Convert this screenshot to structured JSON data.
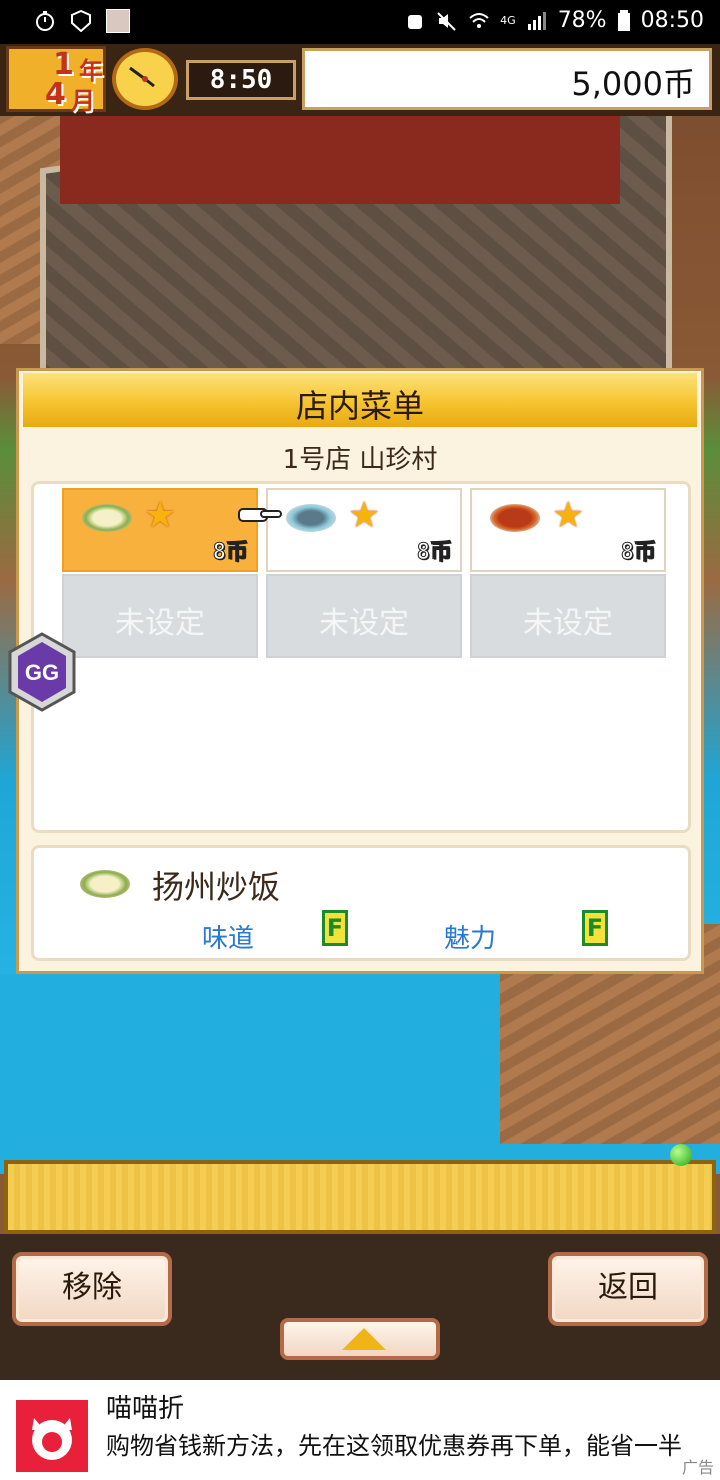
{
  "status_bar": {
    "battery": "78%",
    "time": "08:50",
    "network": "4G"
  },
  "hud": {
    "year": "1",
    "year_unit": "年",
    "month": "4",
    "month_unit": "月",
    "clock_time": "8:50",
    "money": "5,000币"
  },
  "menu_panel": {
    "title": "店内菜单",
    "shop_name": "1号店 山珍村",
    "menu_slots": [
      {
        "price": "8币",
        "rating": 1,
        "selected": true
      },
      {
        "price": "8币",
        "rating": 1,
        "selected": false
      },
      {
        "price": "8币",
        "rating": 1,
        "selected": false
      }
    ],
    "empty_slots": [
      "未设定",
      "未设定",
      "未设定"
    ],
    "selected_dish": {
      "name": "扬州炒饭",
      "taste_label": "味道",
      "taste_grade": "F",
      "charm_label": "魅力",
      "charm_grade": "F"
    }
  },
  "buttons": {
    "remove": "移除",
    "back": "返回"
  },
  "ad": {
    "title": "喵喵折",
    "description": "购物省钱新方法，先在这领取优惠券再下单，能省一半",
    "label": "广告"
  },
  "overlay": {
    "gg_label": "GG"
  }
}
